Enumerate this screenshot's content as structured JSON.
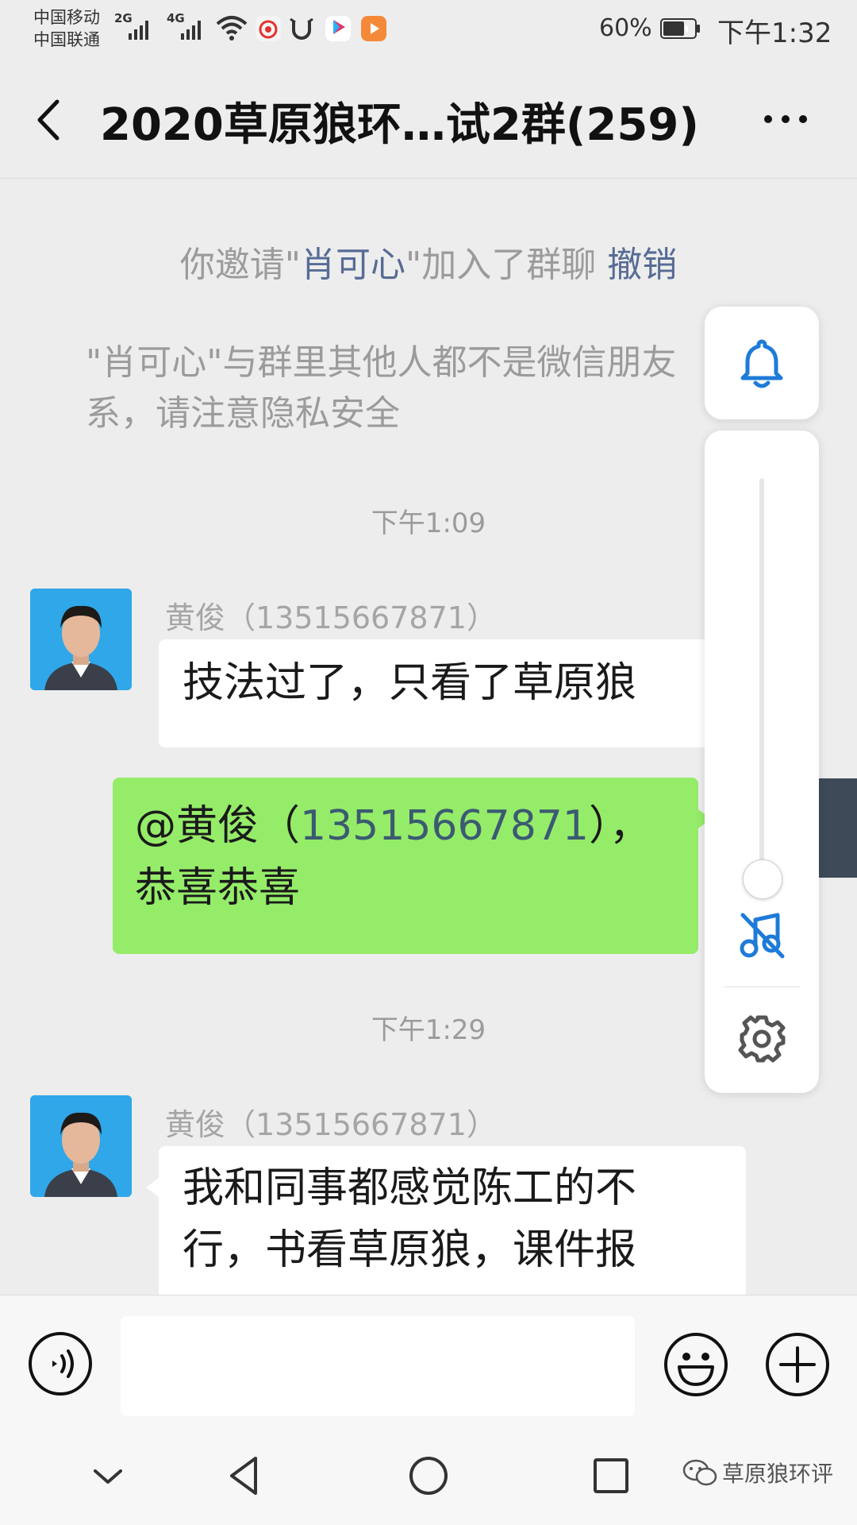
{
  "status_bar": {
    "carrier_1": "中国移动",
    "carrier_2": "中国联通",
    "net_1": "2G",
    "net_2": "4G",
    "battery": "60%",
    "time": "下午1:32",
    "icons": [
      "signal-icon",
      "wifi-icon",
      "weibo-icon",
      "ucloud-icon",
      "youku-icon",
      "video-icon",
      "battery-icon"
    ]
  },
  "header": {
    "title": "2020草原狼环…试2群(259)",
    "back_icon": "chevron-left-icon",
    "more_icon": "more-dots-icon"
  },
  "messages": {
    "invite_prefix": "你邀请\"",
    "invite_name": "肖可心",
    "invite_suffix": "\"加入了群聊  ",
    "revoke_label": "撤销",
    "privacy_notice": "\"肖可心\"与群里其他人都不是微信朋友\n系，请注意隐私安全",
    "time_1": "下午1:09",
    "msg_1_sender": "黄俊（13515667871）",
    "msg_1_text": "技法过了，只看了草原狼",
    "msg_2_mention_prefix": "@黄俊（",
    "msg_2_mention_number": "13515667871",
    "msg_2_mention_suffix": "），",
    "msg_2_text": "恭喜恭喜",
    "time_2": "下午1:29",
    "msg_3_sender": "黄俊（13515667871）",
    "msg_3_text": "我和同事都感觉陈工的不\n行，书看草原狼，课件报"
  },
  "volume_panel": {
    "bell_icon": "bell-icon",
    "level": 0.03,
    "mute_icon": "music-mute-icon",
    "settings_icon": "gear-icon"
  },
  "input_bar": {
    "value": "",
    "placeholder": "",
    "voice_icon": "voice-icon",
    "emoji_icon": "emoji-icon",
    "add_icon": "plus-circle-icon"
  },
  "nav_bar": {
    "buttons": [
      "chevron-down-icon",
      "back-triangle-icon",
      "home-circle-icon",
      "recents-square-icon"
    ],
    "watermark": "草原狼环评"
  },
  "colors": {
    "background": "#ededed",
    "bubble_outgoing": "#95ec69",
    "bubble_incoming": "#ffffff",
    "link": "#576b95",
    "accent_blue": "#1e7bd8"
  }
}
